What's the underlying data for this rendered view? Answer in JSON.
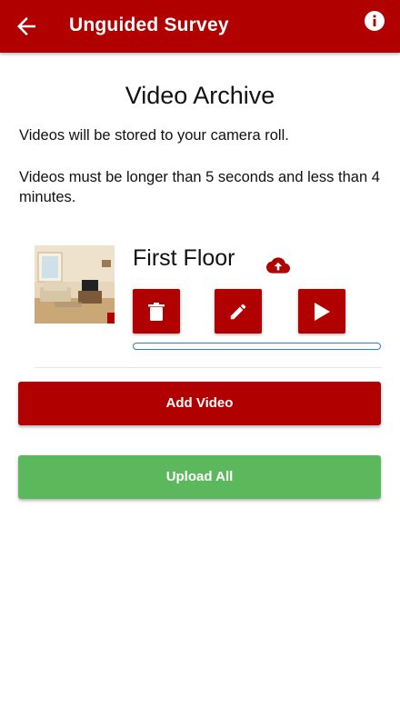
{
  "appbar": {
    "title": "Unguided Survey",
    "back_icon": "arrow-left-icon",
    "info_icon": "info-icon",
    "color": "#b00000"
  },
  "main": {
    "title": "Video Archive",
    "note_storage": "Videos will be stored to your camera roll.",
    "note_length": "Videos must be longer than 5 seconds and less than 4 minutes."
  },
  "videos": [
    {
      "name": "First Floor",
      "thumbnail": "living-room-thumbnail",
      "status_icon": "cloud-upload-icon",
      "actions": [
        "trash-icon",
        "pencil-icon",
        "play-icon"
      ],
      "upload_progress": 0
    }
  ],
  "buttons": {
    "add_video": "Add Video",
    "upload_all": "Upload All",
    "add_color": "#b00000",
    "upload_color": "#5cb85c"
  }
}
